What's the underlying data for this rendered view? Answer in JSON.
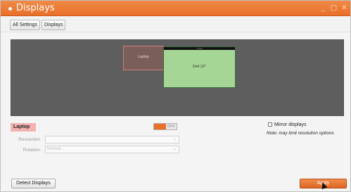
{
  "window": {
    "title": "Displays",
    "controls": {
      "minimize": "_",
      "maximize": "□",
      "close": "✕"
    }
  },
  "breadcrumb": {
    "all_settings": "All Settings",
    "displays": "Displays"
  },
  "arrangement": {
    "monitors": [
      {
        "name": "Laptop",
        "selected": true
      },
      {
        "name": "Dell 22\"",
        "top_bar": "4 2nd",
        "selected": false
      }
    ]
  },
  "selected_display": {
    "name": "Laptop",
    "toggle": {
      "on_label": "",
      "off_label": "OFF",
      "state": "on"
    },
    "resolution": {
      "label": "Resolution",
      "value": ""
    },
    "rotation": {
      "label": "Rotation",
      "value": "Normal"
    }
  },
  "mirror": {
    "label": "Mirror displays",
    "checked": false,
    "note": "Note: may limit resolution options"
  },
  "buttons": {
    "detect": "Detect Displays",
    "apply": "Apply"
  },
  "colors": {
    "accent": "#e8702a",
    "selected_monitor_border": "#d37c7c",
    "dell_monitor_fill": "#a6d696"
  }
}
